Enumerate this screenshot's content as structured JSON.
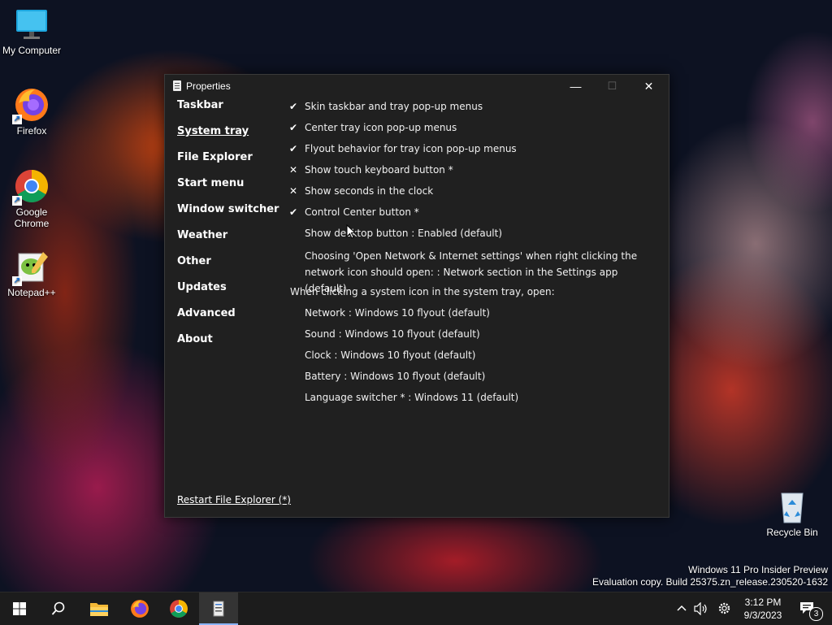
{
  "desktop": {
    "icons": [
      {
        "label": "My Computer",
        "icon": "monitor-icon"
      },
      {
        "label": "Firefox",
        "icon": "firefox-icon"
      },
      {
        "label": "Google Chrome",
        "icon": "chrome-icon"
      },
      {
        "label": "Notepad++",
        "icon": "notepad-plus-plus-icon"
      },
      {
        "label": "Recycle Bin",
        "icon": "recycle-bin-icon"
      }
    ],
    "watermark": {
      "line1": "Windows 11 Pro Insider Preview",
      "line2": "Evaluation copy. Build 25375.zn_release.230520-1632"
    }
  },
  "window": {
    "title": "Properties",
    "controls": {
      "minimize": "—",
      "maximize": "☐",
      "close": "✕"
    },
    "nav": [
      {
        "label": "Taskbar",
        "active": false
      },
      {
        "label": "System tray",
        "active": true
      },
      {
        "label": "File Explorer",
        "active": false
      },
      {
        "label": "Start menu",
        "active": false
      },
      {
        "label": "Window switcher",
        "active": false
      },
      {
        "label": "Weather",
        "active": false
      },
      {
        "label": "Other",
        "active": false
      },
      {
        "label": "Updates",
        "active": false
      },
      {
        "label": "Advanced",
        "active": false
      },
      {
        "label": "About",
        "active": false
      }
    ],
    "options": [
      {
        "mark": "✔",
        "text": "Skin taskbar and tray pop-up menus"
      },
      {
        "mark": "✔",
        "text": "Center tray icon pop-up menus"
      },
      {
        "mark": "✔",
        "text": "Flyout behavior for tray icon pop-up menus"
      },
      {
        "mark": "✕",
        "text": "Show touch keyboard button *"
      },
      {
        "mark": "✕",
        "text": "Show seconds in the clock"
      },
      {
        "mark": "✔",
        "text": "Control Center button *"
      },
      {
        "mark": "",
        "text": "Show desktop button : Enabled (default)"
      },
      {
        "mark": "",
        "text": "Choosing 'Open Network & Internet settings' when right clicking the network icon should open: : Network section in the Settings app (default)"
      },
      {
        "mark": "",
        "text": "When clicking a system icon in the system tray, open:"
      },
      {
        "mark": "",
        "text": "Network : Windows 10 flyout (default)"
      },
      {
        "mark": "",
        "text": "Sound : Windows 10 flyout (default)"
      },
      {
        "mark": "",
        "text": "Clock : Windows 10 flyout (default)"
      },
      {
        "mark": "",
        "text": "Battery : Windows 10 flyout (default)"
      },
      {
        "mark": "",
        "text": "Language switcher * : Windows 11 (default)"
      }
    ],
    "restart_link": "Restart File Explorer (*)"
  },
  "taskbar": {
    "buttons": [
      {
        "name": "start-button",
        "icon": "windows-logo-icon"
      },
      {
        "name": "search-button",
        "icon": "search-icon"
      },
      {
        "name": "file-explorer-button",
        "icon": "folder-icon"
      },
      {
        "name": "firefox-button",
        "icon": "firefox-icon"
      },
      {
        "name": "chrome-button",
        "icon": "chrome-icon"
      },
      {
        "name": "properties-button",
        "icon": "properties-icon"
      }
    ],
    "tray": {
      "chevron": "^",
      "time": "3:12 PM",
      "date": "9/3/2023",
      "notification_count": "3"
    }
  },
  "colors": {
    "window_bg": "#202020",
    "taskbar_bg": "#1c1c1c",
    "accent": "#8ab4f8"
  }
}
